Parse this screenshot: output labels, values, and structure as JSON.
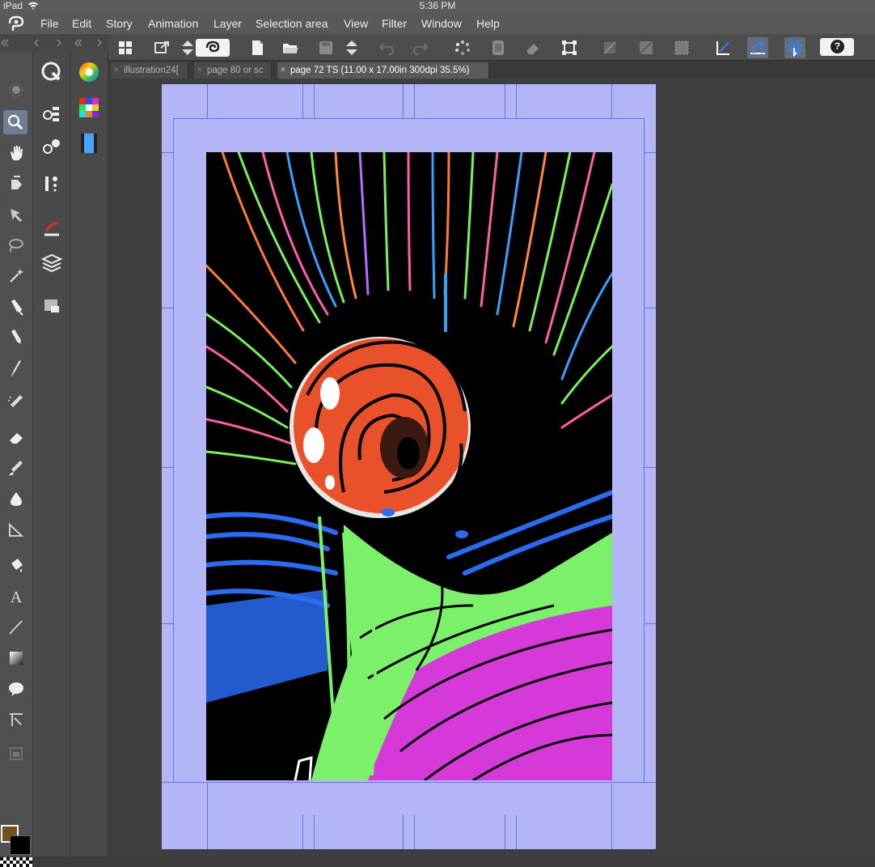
{
  "status": {
    "device": "iPad",
    "time": "5:36 PM"
  },
  "menu": {
    "items": [
      "File",
      "Edit",
      "Story",
      "Animation",
      "Layer",
      "Selection area",
      "View",
      "Filter",
      "Window",
      "Help"
    ]
  },
  "tabs": [
    {
      "label": "illustration24[",
      "active": false
    },
    {
      "label": "page 80 or sc",
      "active": false
    },
    {
      "label": "page 72 TS (11.00 x 17.00in 300dpi 35.5%)",
      "active": true
    }
  ],
  "toolbar_icons": [
    "grid-icon",
    "export-icon",
    "spin-icon",
    "clip-logo-icon",
    "new-file-icon",
    "open-folder-icon",
    "save-icon",
    "spin-icon",
    "undo-icon",
    "redo-icon",
    "loading-icon",
    "fill-icon",
    "eraser-icon",
    "transform-icon",
    "clear-icon",
    "clear-outside-icon",
    "select-all-icon",
    "ruler-snap-icon",
    "special-ruler-icon",
    "grid-snap-icon",
    "help-icon"
  ],
  "colors": {
    "accent": "#6f7f93",
    "paper": "#b3b5f7",
    "guide": "#6a73d8",
    "main_color": "#7a4f1e",
    "sub_color": "#000000",
    "orb": "#e8512a",
    "stem_green": "#7cf06a",
    "magenta": "#d53ad8",
    "blue": "#2a6bf0"
  },
  "tools": [
    "zoom-icon",
    "hand-icon",
    "rotate-icon",
    "move-icon",
    "lasso-icon",
    "magic-wand-icon",
    "pen-icon",
    "pencil-icon",
    "brush-icon",
    "airbrush-icon",
    "eraser-icon",
    "blend-icon",
    "fill-drop-icon",
    "ruler-icon",
    "fill-bucket-icon",
    "text-icon",
    "line-icon",
    "gradient-icon",
    "balloon-icon",
    "frame-icon"
  ]
}
